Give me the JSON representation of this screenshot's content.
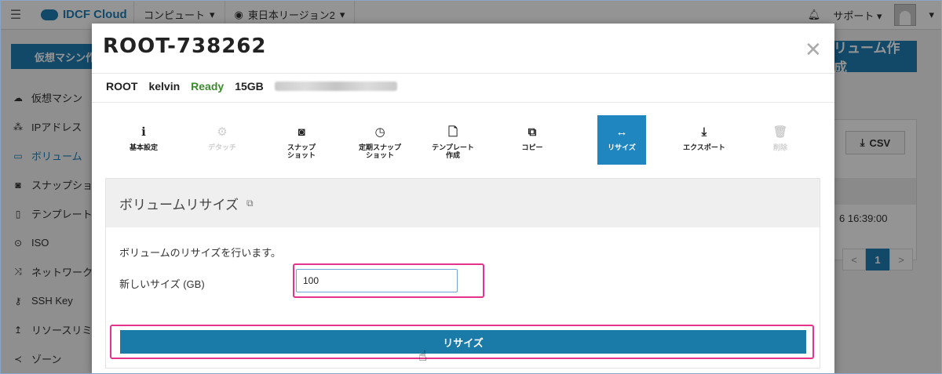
{
  "topbar": {
    "logo_text": "IDCF Cloud",
    "nav_compute": "コンピュート",
    "nav_region": "東日本リージョン2",
    "support": "サポート"
  },
  "sidebar": {
    "create_vm": "仮想マシン作",
    "items": [
      {
        "label": "仮想マシン",
        "icon": "cloud-icon"
      },
      {
        "label": "IPアドレス",
        "icon": "network-icon"
      },
      {
        "label": "ボリューム",
        "icon": "volume-icon"
      },
      {
        "label": "スナップショ",
        "icon": "camera-icon"
      },
      {
        "label": "テンプレート",
        "icon": "file-icon"
      },
      {
        "label": "ISO",
        "icon": "disc-icon"
      },
      {
        "label": "ネットワーク",
        "icon": "shuffle-icon"
      },
      {
        "label": "SSH Key",
        "icon": "key-icon"
      },
      {
        "label": "リソースリミ",
        "icon": "arrow-icon"
      },
      {
        "label": "ゾーン",
        "icon": "share-icon"
      }
    ]
  },
  "background": {
    "create_volume": "リューム作成",
    "csv": "CSV",
    "time": "6 16:39:00",
    "page": "1"
  },
  "modal": {
    "title": "ROOT-738262",
    "info": {
      "type": "ROOT",
      "vm": "kelvin",
      "status": "Ready",
      "size": "15GB"
    },
    "tabs": [
      {
        "label": "基本設定",
        "icon": "info-icon",
        "state": "normal"
      },
      {
        "label": "デタッチ",
        "icon": "gear-icon",
        "state": "disabled"
      },
      {
        "label": "スナップ\nショット",
        "icon": "camera-icon",
        "state": "normal"
      },
      {
        "label": "定期スナップ\nショット",
        "icon": "clock-icon",
        "state": "normal"
      },
      {
        "label": "テンプレート\n作成",
        "icon": "file-icon",
        "state": "normal"
      },
      {
        "label": "コピー",
        "icon": "copy-icon",
        "state": "normal"
      },
      {
        "label": "リサイズ",
        "icon": "resize-icon",
        "state": "active"
      },
      {
        "label": "エクスポート",
        "icon": "download-icon",
        "state": "normal"
      },
      {
        "label": "削除",
        "icon": "trash-icon",
        "state": "disabled"
      }
    ],
    "panel": {
      "heading": "ボリュームリサイズ",
      "description": "ボリュームのリサイズを行います。",
      "size_label": "新しいサイズ (GB)",
      "size_value": "100",
      "submit_label": "リサイズ"
    }
  },
  "colors": {
    "accent": "#1f86c0",
    "highlight": "#e5338b",
    "ready": "#3c8a2e"
  }
}
